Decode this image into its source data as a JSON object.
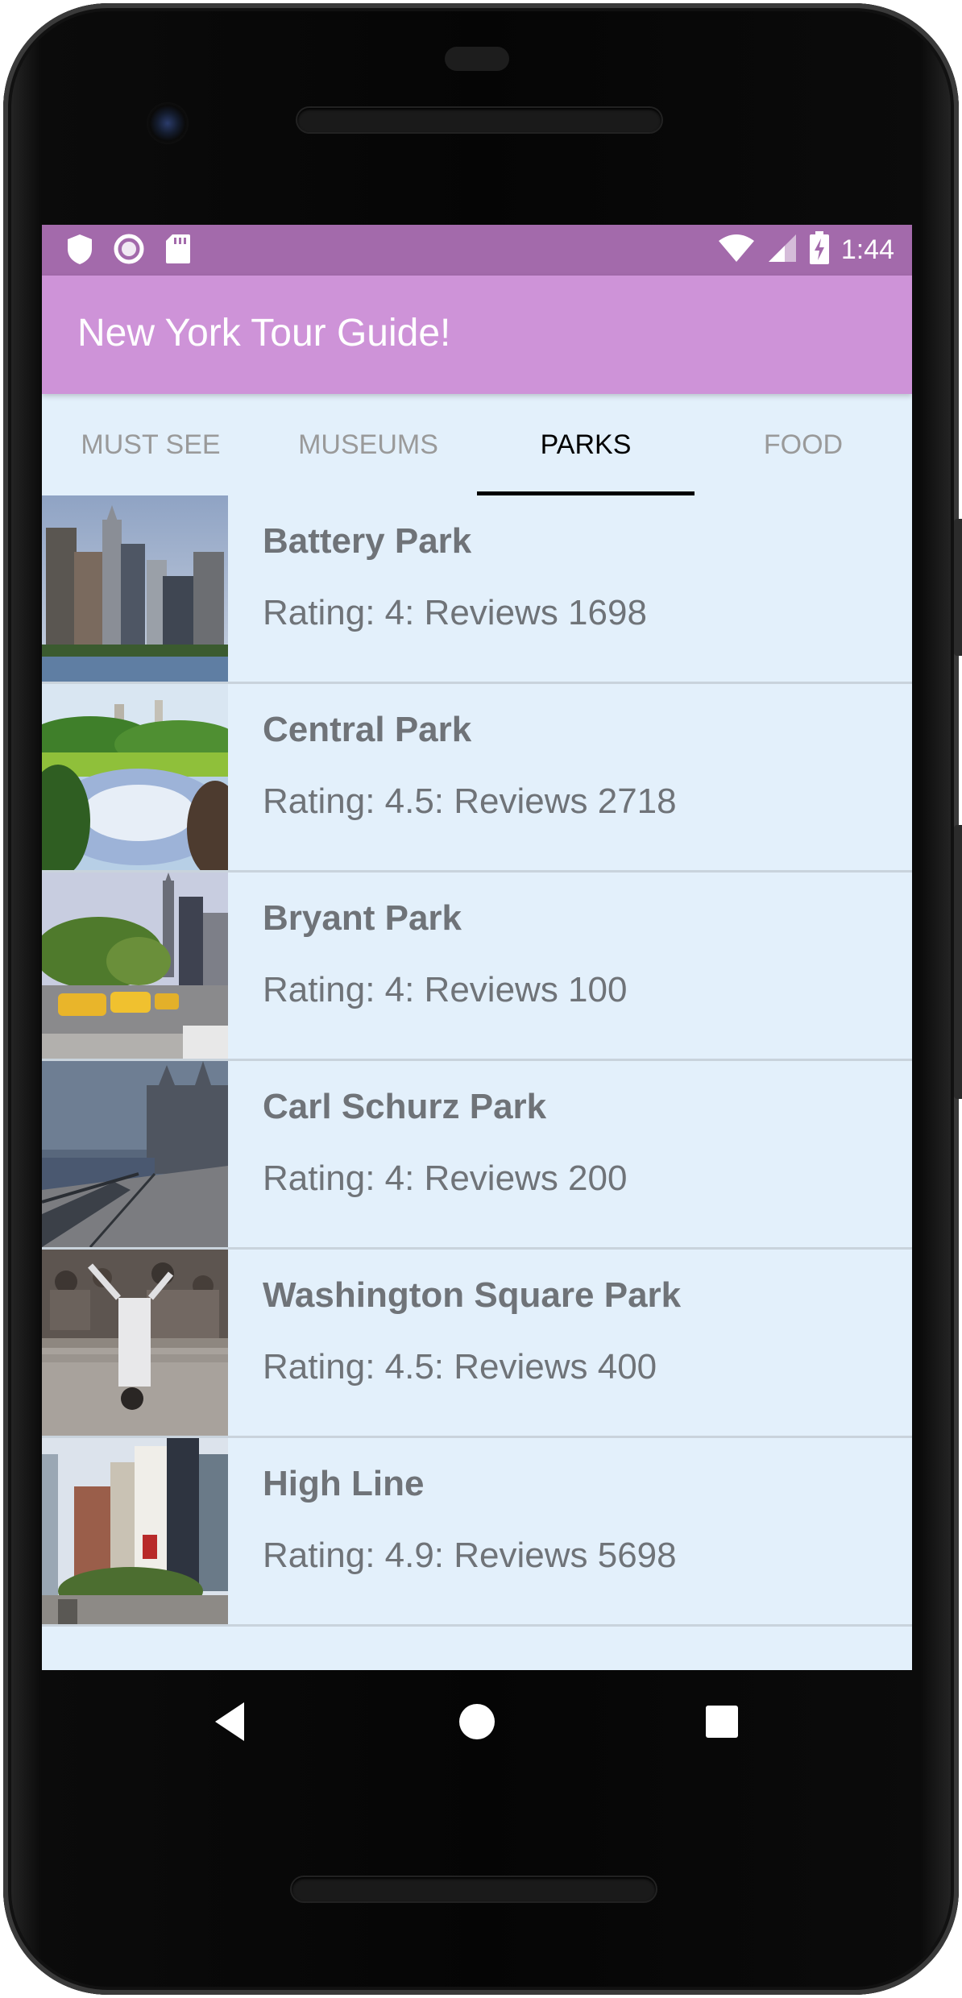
{
  "status_bar": {
    "time": "1:44",
    "left_icons": [
      "shield-icon",
      "record-icon",
      "sd-card-icon"
    ],
    "right_icons": [
      "wifi-icon",
      "signal-icon",
      "battery-charging-icon"
    ]
  },
  "app_bar": {
    "title": "New York Tour Guide!",
    "color": "#ce93d8"
  },
  "tabs": [
    {
      "label": "MUST SEE",
      "active": false
    },
    {
      "label": "MUSEUMS",
      "active": false
    },
    {
      "label": "PARKS",
      "active": true
    },
    {
      "label": "FOOD",
      "active": false
    }
  ],
  "places": [
    {
      "name": "Battery Park",
      "rating": "Rating: 4: Reviews 1698",
      "image": "skyline-waterfront-photo"
    },
    {
      "name": "Central Park",
      "rating": "Rating: 4.5: Reviews 2718",
      "image": "park-pond-photo"
    },
    {
      "name": "Bryant Park",
      "rating": "Rating: 4: Reviews 100",
      "image": "street-taxis-photo"
    },
    {
      "name": "Carl Schurz Park",
      "rating": "Rating: 4: Reviews 200",
      "image": "riverside-promenade-photo"
    },
    {
      "name": "Washington Square Park",
      "rating": "Rating: 4.5: Reviews 400",
      "image": "street-dancer-photo"
    },
    {
      "name": "High Line",
      "rating": "Rating: 4.9: Reviews 5698",
      "image": "city-buildings-photo"
    }
  ],
  "nav_bar": {
    "icons": [
      "back-icon",
      "home-icon",
      "recents-icon"
    ]
  },
  "colors": {
    "status_bar": "#a36aab",
    "screen_background": "#e3f0fb",
    "text": "#6f7378"
  }
}
